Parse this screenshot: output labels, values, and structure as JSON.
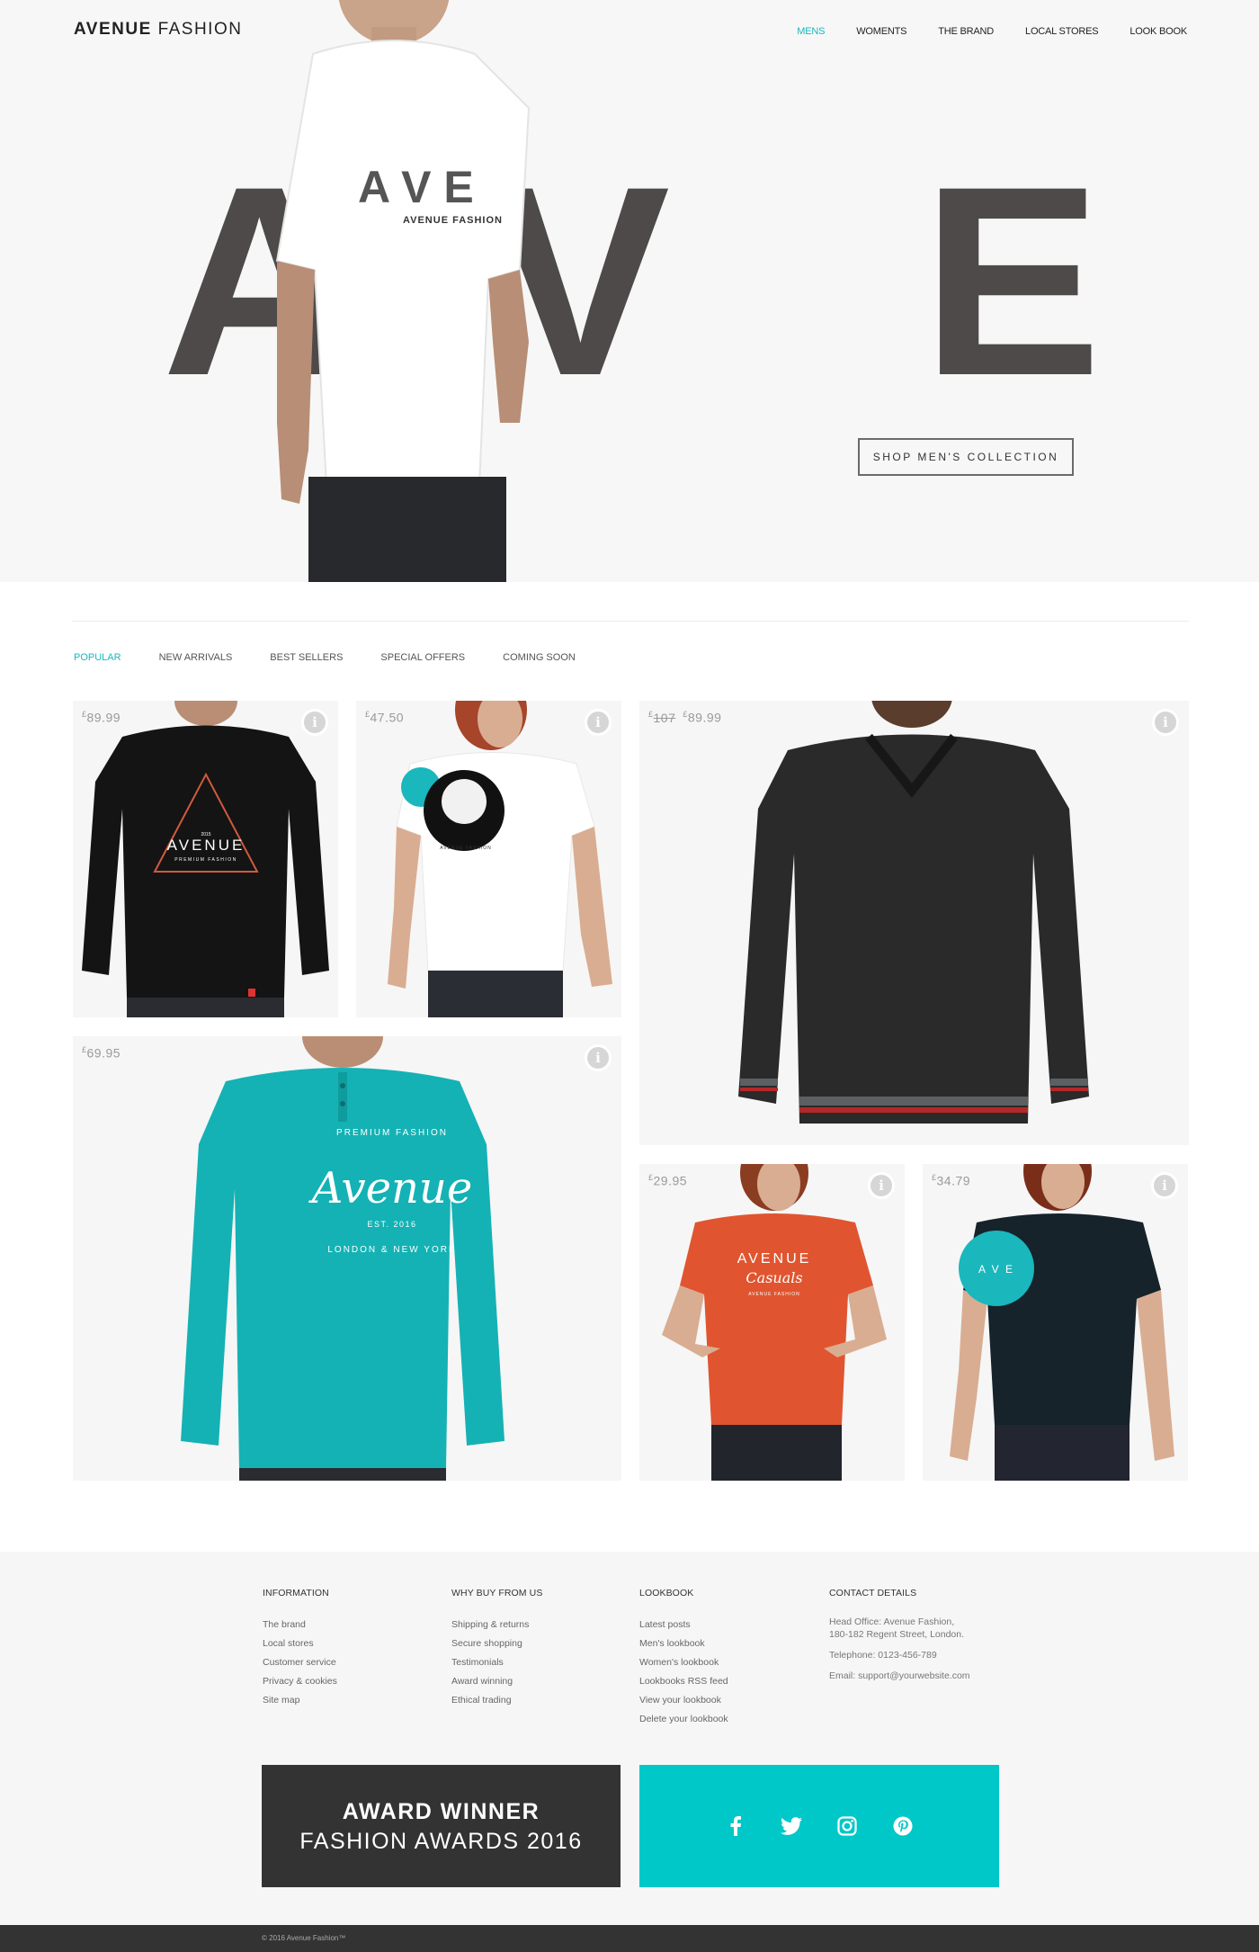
{
  "brand": {
    "bold": "AVENUE",
    "light": "FASHION"
  },
  "nav": [
    {
      "label": "MENS",
      "active": true
    },
    {
      "label": "WOMENTS",
      "active": false
    },
    {
      "label": "THE BRAND",
      "active": false
    },
    {
      "label": "LOCAL STORES",
      "active": false
    },
    {
      "label": "LOOK BOOK",
      "active": false
    }
  ],
  "hero": {
    "letters": [
      "A",
      "V",
      "E"
    ],
    "shirt_print": {
      "letters": "A V E",
      "caption": "AVENUE FASHION"
    },
    "cta": "SHOP MEN'S COLLECTION"
  },
  "tabs": [
    {
      "label": "POPULAR",
      "active": true
    },
    {
      "label": "NEW ARRIVALS",
      "active": false
    },
    {
      "label": "BEST SELLERS",
      "active": false
    },
    {
      "label": "SPECIAL OFFERS",
      "active": false
    },
    {
      "label": "COMING SOON",
      "active": false
    }
  ],
  "currency": "£",
  "products": [
    {
      "price": "89.99",
      "old_price": "",
      "item": "black long-sleeve tee",
      "print": {
        "year": "2015",
        "word": "AVENUE",
        "tag": "PREMIUM FASHION"
      }
    },
    {
      "price": "47.50",
      "old_price": "",
      "item": "white women's tee",
      "print": {
        "tag": "AVENUE FASHION"
      }
    },
    {
      "price": "89.99",
      "old_price": "107",
      "item": "black knit sweater",
      "print": {}
    },
    {
      "price": "69.95",
      "old_price": "",
      "item": "teal henley",
      "print": {
        "top": "PREMIUM FASHION",
        "script": "Avenue",
        "est": "EST. 2016",
        "bottom": "LONDON & NEW YORK"
      }
    },
    {
      "price": "29.95",
      "old_price": "",
      "item": "orange women's tee",
      "print": {
        "word": "AVENUE",
        "script": "Casuals",
        "tag": "AVENUE FASHION"
      }
    },
    {
      "price": "34.79",
      "old_price": "",
      "item": "navy women's tee",
      "print": {
        "word": "A V E"
      }
    }
  ],
  "footer": {
    "information": {
      "title": "INFORMATION",
      "links": [
        "The brand",
        "Local stores",
        "Customer service",
        "Privacy & cookies",
        "Site map"
      ]
    },
    "why": {
      "title": "WHY BUY FROM US",
      "links": [
        "Shipping & returns",
        "Secure shopping",
        "Testimonials",
        "Award winning",
        "Ethical trading"
      ]
    },
    "lookbook": {
      "title": "LOOKBOOK",
      "links": [
        "Latest posts",
        "Men's lookbook",
        "Women's lookbook",
        "Lookbooks RSS feed",
        "View your lookbook",
        "Delete your lookbook"
      ]
    },
    "contact": {
      "title": "CONTACT DETAILS",
      "address_line1": "Head Office: Avenue Fashion,",
      "address_line2": "180-182 Regent Street, London.",
      "telephone": "Telephone: 0123-456-789",
      "email": "Email: support@yourwebsite.com"
    }
  },
  "award": {
    "line1": "AWARD WINNER",
    "line2": "FASHION AWARDS 2016"
  },
  "social_icons": [
    "facebook-icon",
    "twitter-icon",
    "instagram-icon",
    "pinterest-icon"
  ],
  "copyright": "© 2016 Avenue Fashion™",
  "colors": {
    "accent": "#1ab7bd",
    "social_bg": "#00c7c8",
    "dark": "#333333",
    "hero_letters": "#4e4a4a"
  }
}
